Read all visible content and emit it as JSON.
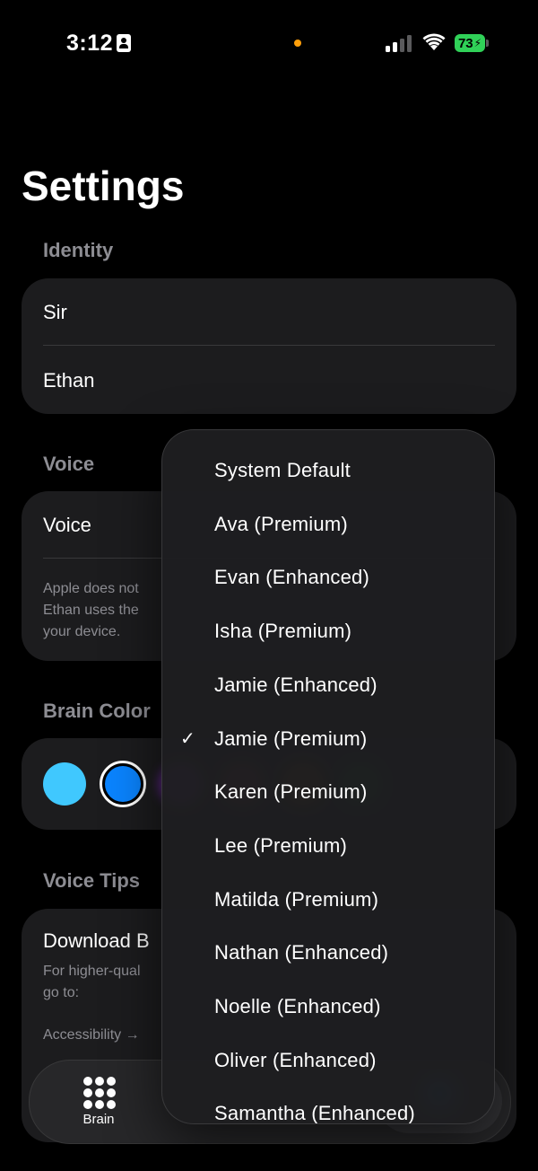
{
  "status_bar": {
    "time": "3:12",
    "battery": "73"
  },
  "page_title": "Settings",
  "identity": {
    "header": "Identity",
    "user_name": "Sir",
    "assistant_name": "Ethan"
  },
  "voice": {
    "header": "Voice",
    "row_label": "Voice",
    "footnote_lines": [
      "Apple does not",
      "Ethan uses the",
      "your device."
    ]
  },
  "brain_color": {
    "header": "Brain Color",
    "colors": [
      "#40c8fe",
      "#0a84ff",
      "#8e2bd8",
      "#c62a5a",
      "#d9770c",
      "#17a23a"
    ],
    "selected_index": 1
  },
  "voice_tips": {
    "header": "Voice Tips",
    "title": "Download B",
    "body_lines": [
      "For higher-qual",
      "go to:"
    ],
    "path": "Accessibility →"
  },
  "tab_bar": {
    "brain_label": "Brain"
  },
  "voice_menu": {
    "selected": "Jamie (Premium)",
    "options": [
      "System Default",
      "Ava (Premium)",
      "Evan (Enhanced)",
      "Isha (Premium)",
      "Jamie (Enhanced)",
      "Jamie (Premium)",
      "Karen (Premium)",
      "Lee (Premium)",
      "Matilda (Premium)",
      "Nathan (Enhanced)",
      "Noelle (Enhanced)",
      "Oliver (Enhanced)",
      "Samantha (Enhanced)"
    ]
  }
}
